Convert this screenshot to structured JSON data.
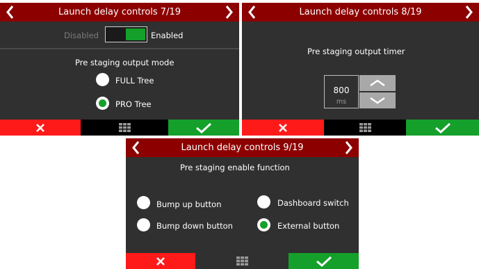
{
  "colors": {
    "header": "#8c0000",
    "cancel": "#ff1a1a",
    "confirm": "#14a02a",
    "panel": "#303030"
  },
  "icons": {
    "prev": "chevron-left-icon",
    "next": "chevron-right-icon",
    "cancel": "close-icon",
    "menu": "grid-icon",
    "confirm": "check-icon"
  },
  "screen1": {
    "title": "Launch delay controls 7/19",
    "toggle": {
      "off_label": "Disabled",
      "on_label": "Enabled",
      "state": "enabled"
    },
    "section_title": "Pre staging output mode",
    "options": [
      {
        "label": "FULL Tree",
        "selected": false
      },
      {
        "label": "PRO Tree",
        "selected": true
      }
    ]
  },
  "screen2": {
    "title": "Launch delay controls 8/19",
    "section_title": "Pre staging output timer",
    "stepper": {
      "value": "800",
      "unit": "ms"
    }
  },
  "screen3": {
    "title": "Launch delay controls 9/19",
    "section_title": "Pre staging enable function",
    "options": [
      {
        "label": "Bump up button",
        "selected": false
      },
      {
        "label": "Dashboard switch",
        "selected": false
      },
      {
        "label": "Bump down button",
        "selected": false
      },
      {
        "label": "External button",
        "selected": true
      }
    ]
  }
}
